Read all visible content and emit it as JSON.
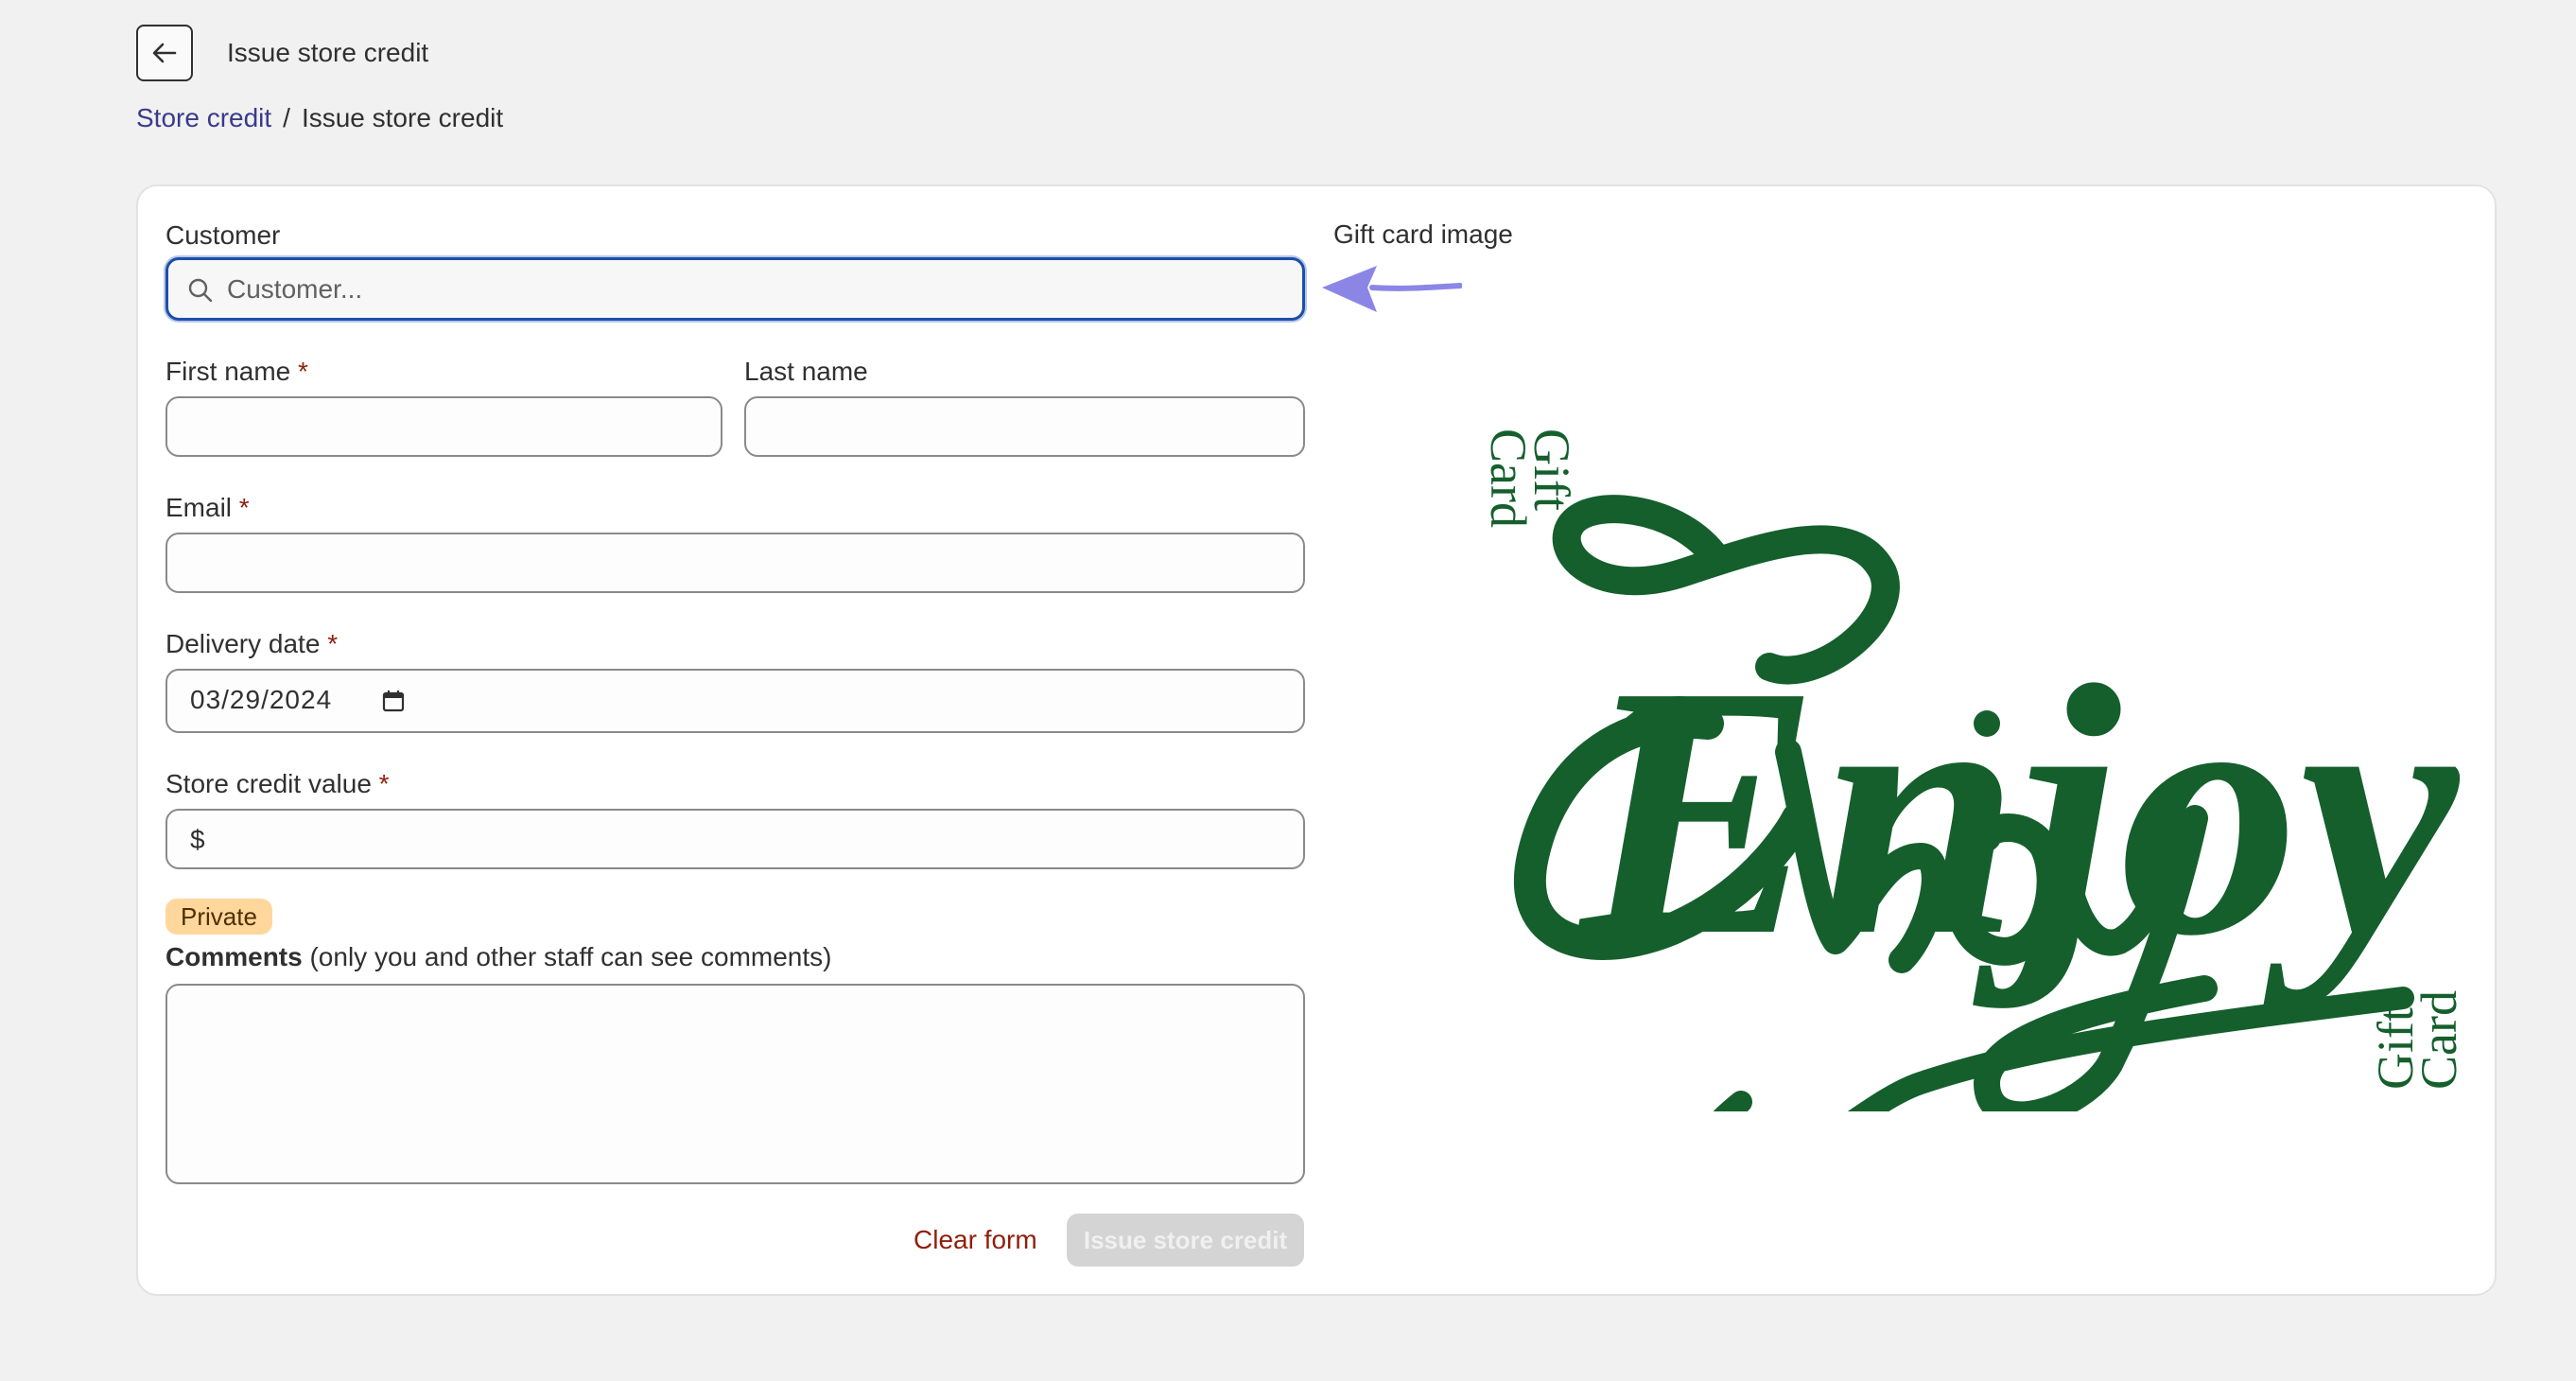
{
  "header": {
    "title": "Issue store credit",
    "back_icon": "arrow-left-icon"
  },
  "breadcrumb": {
    "link": "Store credit",
    "separator": "/",
    "current": "Issue store credit"
  },
  "form": {
    "customer": {
      "label": "Customer",
      "placeholder": "Customer...",
      "icon": "search-icon"
    },
    "first_name": {
      "label": "First name",
      "required": "*",
      "value": ""
    },
    "last_name": {
      "label": "Last name",
      "value": ""
    },
    "email": {
      "label": "Email",
      "required": "*",
      "value": ""
    },
    "delivery_date": {
      "label": "Delivery date",
      "required": "*",
      "value": "03/29/2024",
      "icon": "calendar-icon"
    },
    "store_credit_value": {
      "label": "Store credit value",
      "required": "*",
      "prefix": "$",
      "value": ""
    },
    "private_badge": "Private",
    "comments": {
      "label_bold": "Comments",
      "label_rest": " (only you and other staff can see comments)",
      "value": ""
    },
    "clear_button": "Clear form",
    "issue_button": "Issue store credit"
  },
  "gift_card": {
    "label": "Gift card image",
    "script_text": "Enjoy",
    "side_text_top": "Gift",
    "side_text_bottom": "Card",
    "color": "#155f2d"
  },
  "accent_colors": {
    "focus": "#1d4fa8",
    "link": "#3a3a8c",
    "required": "#8e1f0b",
    "annotation_arrow": "#8b86e6"
  }
}
